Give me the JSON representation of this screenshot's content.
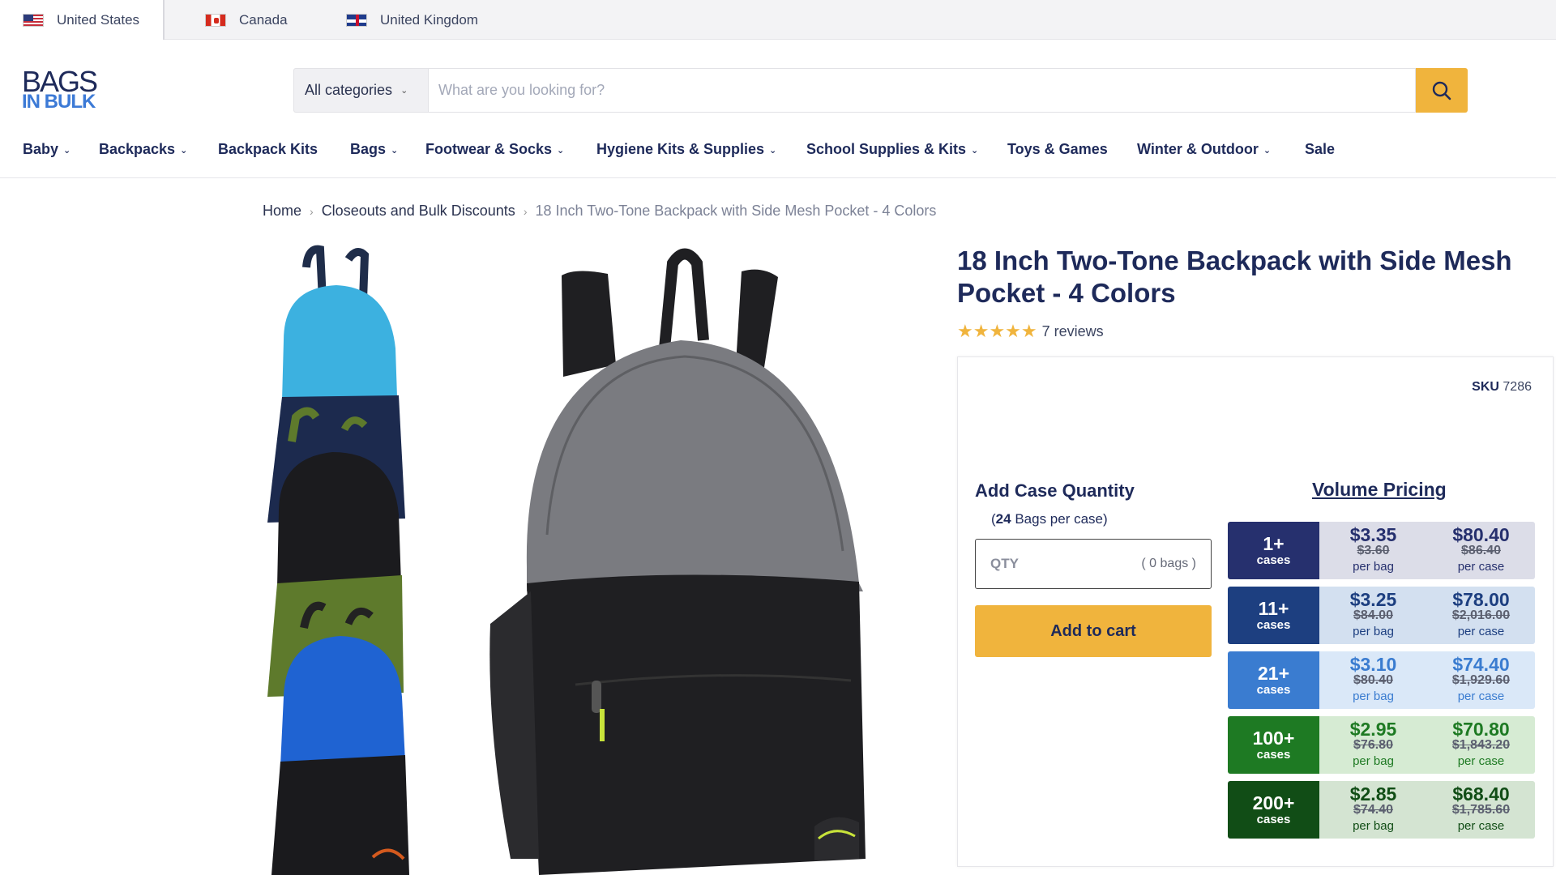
{
  "countries": [
    {
      "name": "United States",
      "flag": "us-flag-icon"
    },
    {
      "name": "Canada",
      "flag": "canada-flag-icon"
    },
    {
      "name": "United Kingdom",
      "flag": "uk-flag-icon"
    }
  ],
  "logo": {
    "line1": "BAGS",
    "line2": "IN BULK"
  },
  "search": {
    "category": "All categories",
    "placeholder": "What are you looking for?",
    "button_icon": "search-icon"
  },
  "nav": [
    {
      "label": "Baby",
      "dropdown": true
    },
    {
      "label": "Backpacks",
      "dropdown": true
    },
    {
      "label": "Backpack Kits",
      "dropdown": false
    },
    {
      "label": "Bags",
      "dropdown": true
    },
    {
      "label": "Footwear & Socks",
      "dropdown": true
    },
    {
      "label": "Hygiene Kits & Supplies",
      "dropdown": true
    },
    {
      "label": "School Supplies & Kits",
      "dropdown": true
    },
    {
      "label": "Toys & Games",
      "dropdown": false
    },
    {
      "label": "Winter & Outdoor",
      "dropdown": true
    },
    {
      "label": "Sale",
      "dropdown": false
    }
  ],
  "breadcrumb": {
    "home": "Home",
    "category": "Closeouts and Bulk Discounts",
    "current": "18 Inch Two-Tone Backpack with Side Mesh Pocket - 4 Colors"
  },
  "product": {
    "title": "18 Inch Two-Tone Backpack with Side Mesh Pocket - 4 Colors",
    "rating": 4.5,
    "stars": "★★★★★",
    "reviews": "7 reviews",
    "sku_label": "SKU",
    "sku": "7286",
    "image_main": "gray-black-backpack-image",
    "image_stack": "stacked-backpacks-image"
  },
  "purchase": {
    "add_label": "Add Case Quantity",
    "case_open": "(",
    "bags_per_case": "24",
    "case_suffix": " Bags per case)",
    "qty_placeholder": "QTY",
    "qty_bags": "( 0 bags )",
    "add_to_cart": "Add to cart"
  },
  "volume_pricing": {
    "title": "Volume Pricing",
    "cases_label": "cases",
    "per_bag_label": "per bag",
    "per_case_label": "per case",
    "tiers": [
      {
        "qty": "1+",
        "bag_price": "$3.35",
        "bag_old": "$3.60",
        "case_price": "$80.40",
        "case_old": "$86.40",
        "dark": "#26306e",
        "light": "#dcdde8",
        "text": "#26306e"
      },
      {
        "qty": "11+",
        "bag_price": "$3.25",
        "bag_old": "$84.00",
        "case_price": "$78.00",
        "case_old": "$2,016.00",
        "dark": "#1d3f80",
        "light": "#d3e0f0",
        "text": "#1d3f80"
      },
      {
        "qty": "21+",
        "bag_price": "$3.10",
        "bag_old": "$80.40",
        "case_price": "$74.40",
        "case_old": "$1,929.60",
        "dark": "#3a7cd0",
        "light": "#dae8f8",
        "text": "#3a7cd0"
      },
      {
        "qty": "100+",
        "bag_price": "$2.95",
        "bag_old": "$76.80",
        "case_price": "$70.80",
        "case_old": "$1,843.20",
        "dark": "#1e7a23",
        "light": "#d6ebd3",
        "text": "#1e7a23"
      },
      {
        "qty": "200+",
        "bag_price": "$2.85",
        "bag_old": "$74.40",
        "case_price": "$68.40",
        "case_old": "$1,785.60",
        "dark": "#114d16",
        "light": "#d4e4d2",
        "text": "#114d16"
      }
    ]
  }
}
